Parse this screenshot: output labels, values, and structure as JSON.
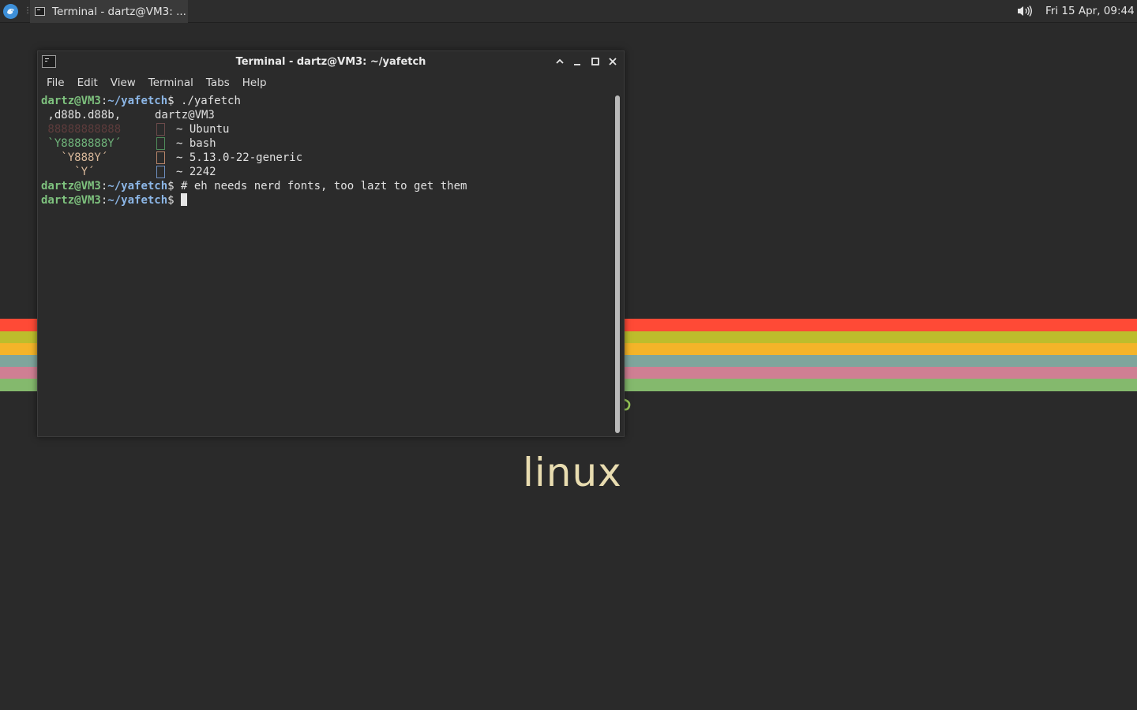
{
  "panel": {
    "task_label": "Terminal - dartz@VM3: ...",
    "clock": "Fri 15 Apr, 09:44"
  },
  "wallpaper": {
    "stripes": [
      "#ff4a36",
      "#bdbd2c",
      "#f4b429",
      "#7fa59c",
      "#cf7f93",
      "#84b96d"
    ],
    "text": "linux"
  },
  "window": {
    "title": "Terminal - dartz@VM3: ~/yafetch",
    "menu": [
      "File",
      "Edit",
      "View",
      "Terminal",
      "Tabs",
      "Help"
    ]
  },
  "terminal": {
    "prompt_user": "dartz@VM3",
    "prompt_dir": "~/yafetch",
    "cmd1": "./yafetch",
    "art1": " ,d88b.d88b,",
    "art2": " 88888888888",
    "art3": " `Y8888888Y´",
    "art4": "   `Y888Y´",
    "art5": "     `Y´",
    "host": "dartz@VM3",
    "os": "~ Ubuntu",
    "shell": "~ bash",
    "kernel": "~ 5.13.0-22-generic",
    "pkgs": "~ 2242",
    "cmd2": "# eh needs nerd fonts, too lazt to get them",
    "glyph_colors": [
      "#6b4a4a",
      "#4f8c5b",
      "#b8856a",
      "#6e8fc0"
    ]
  }
}
